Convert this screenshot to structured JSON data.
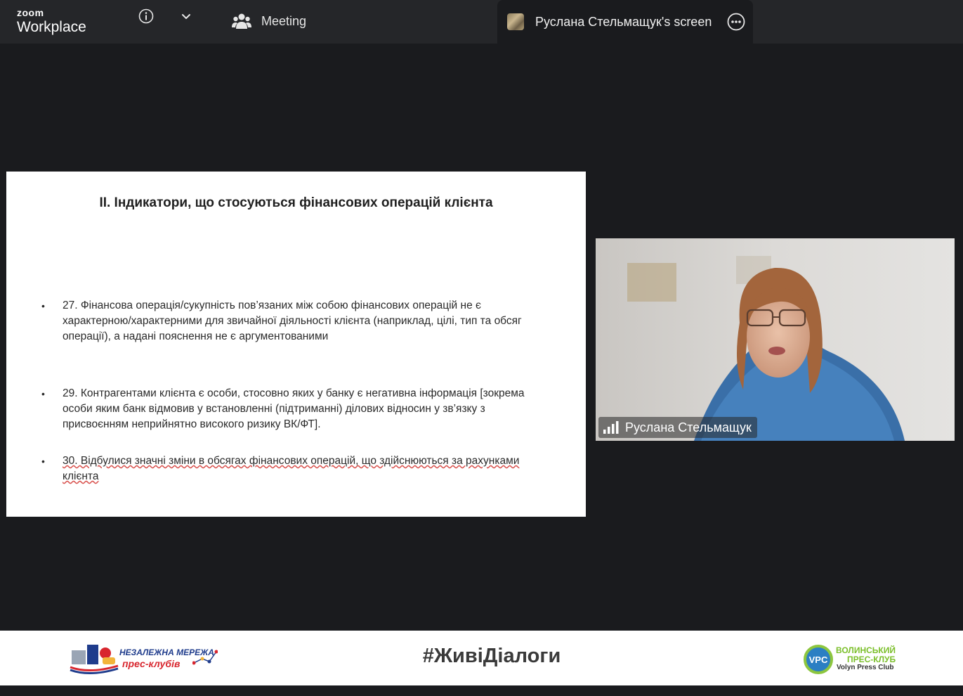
{
  "header": {
    "brand_top": "zoom",
    "brand_bottom": "Workplace",
    "meeting_label": "Meeting",
    "screen_tab_label": "Руслана Стельмащук's screen",
    "icons": [
      "info-icon",
      "chevron-down-icon",
      "meeting-icon",
      "more-icon"
    ]
  },
  "slide": {
    "title": "ІІ. Індикатори, що стосуються фінансових операцій клієнта",
    "bullets": [
      {
        "text": "27. Фінансова операція/сукупність пов’язаних між собою фінансових операцій не є характерною/характерними для звичайної діяльності клієнта (наприклад, цілі, тип та обсяг операції), а надані пояснення не є аргументованими"
      },
      {
        "text": "29. Контрагентами клієнта є особи, стосовно яких у банку є негативна інформація [зокрема особи яким банк відмовив у встановленні (підтриманні) ділових відносин у зв’язку з присвоєнням неприйнятно високого ризику ВК/ФТ]."
      },
      {
        "text": "30. Відбулися значні зміни в обсягах фінансових операцій, що здійснюються за рахунками клієнта"
      }
    ]
  },
  "video": {
    "participant_name": "Руслана Стельмащук"
  },
  "footer": {
    "hashtag": "#ЖивіДіалоги",
    "left_logo": {
      "line1": "НЕЗАЛЕЖНА МЕРЕЖА",
      "line2": "прес-клубів"
    },
    "right_logo": {
      "badge": "VPC",
      "line1": "ВОЛИНСЬКИЙ",
      "line2": "ПРЕС-КЛУБ",
      "line3": "Volyn Press Club"
    }
  },
  "colors": {
    "app_bg": "#1a1b1e",
    "topbar_bg": "#252629",
    "accent_green": "#7bbf2a",
    "accent_blue": "#1f3c8c",
    "accent_red": "#d8262e"
  }
}
